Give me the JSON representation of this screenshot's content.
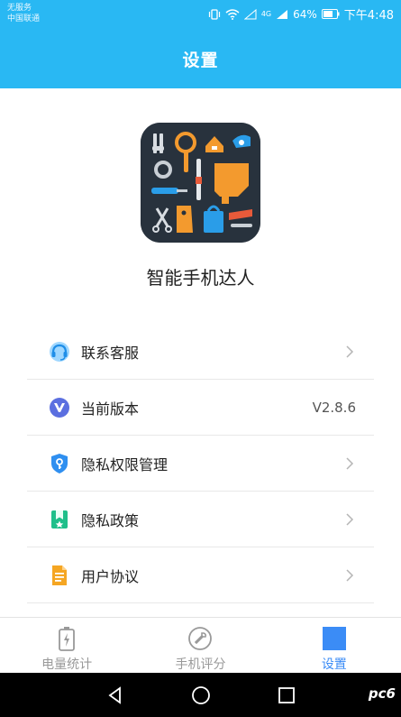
{
  "statusbar": {
    "carrier_line1": "无服务",
    "carrier_line2": "中国联通",
    "battery": "64%",
    "time": "下午4:48",
    "network": "4G"
  },
  "header": {
    "title": "设置"
  },
  "app": {
    "name": "智能手机达人"
  },
  "menu": {
    "items": [
      {
        "label": "联系客服",
        "icon": "headset-icon"
      },
      {
        "label": "当前版本",
        "icon": "version-v-icon",
        "value": "V2.8.6"
      },
      {
        "label": "隐私权限管理",
        "icon": "shield-key-icon"
      },
      {
        "label": "隐私政策",
        "icon": "bookmark-star-icon"
      },
      {
        "label": "用户协议",
        "icon": "document-icon"
      }
    ]
  },
  "tabbar": {
    "tabs": [
      {
        "label": "电量统计",
        "icon": "battery-icon"
      },
      {
        "label": "手机评分",
        "icon": "wrench-circle-icon"
      },
      {
        "label": "设置",
        "icon": "settings-square-icon",
        "active": true
      }
    ]
  },
  "navbar": {
    "buttons": [
      "back-icon",
      "home-icon",
      "recents-icon"
    ]
  },
  "watermark": "pc6"
}
